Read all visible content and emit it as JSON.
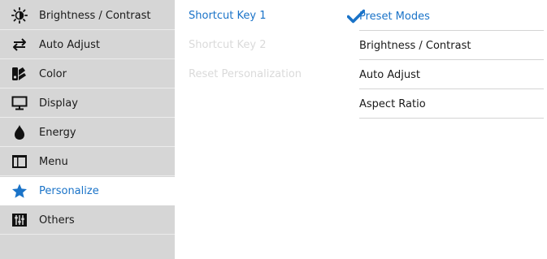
{
  "sidebar": {
    "items": [
      {
        "label": "Brightness / Contrast",
        "icon": "brightness-icon"
      },
      {
        "label": "Auto Adjust",
        "icon": "auto-adjust-icon"
      },
      {
        "label": "Color",
        "icon": "color-icon"
      },
      {
        "label": "Display",
        "icon": "display-icon"
      },
      {
        "label": "Energy",
        "icon": "energy-icon"
      },
      {
        "label": "Menu",
        "icon": "menu-icon"
      },
      {
        "label": "Personalize",
        "icon": "star-icon",
        "active": true
      },
      {
        "label": "Others",
        "icon": "others-icon"
      }
    ]
  },
  "submenu": {
    "items": [
      {
        "label": "Shortcut Key 1",
        "state": "active"
      },
      {
        "label": "Shortcut Key 2",
        "state": "disabled"
      },
      {
        "label": "Reset Personalization",
        "state": "disabled"
      }
    ]
  },
  "options": {
    "items": [
      {
        "label": "Preset Modes",
        "selected": true
      },
      {
        "label": "Brightness / Contrast",
        "selected": false
      },
      {
        "label": "Auto Adjust",
        "selected": false
      },
      {
        "label": "Aspect Ratio",
        "selected": false
      }
    ]
  },
  "colors": {
    "accent": "#1a73c8",
    "sidebar_bg": "#d6d6d6",
    "disabled_text": "#dadada"
  }
}
